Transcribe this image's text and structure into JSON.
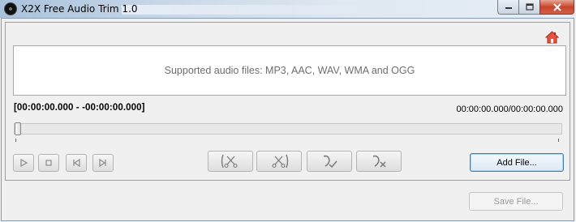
{
  "window": {
    "title": "X2X Free Audio Trim 1.0",
    "app_icon": "app-logo-icon",
    "controls": [
      "minimize-icon",
      "maximize-icon",
      "close-icon"
    ]
  },
  "toolbar": {
    "home_icon": "home-icon"
  },
  "drop_area": {
    "text": "Supported audio files: MP3, AAC, WAV, WMA and OGG"
  },
  "selection": {
    "range": "[00:00:00.000 - -00:00:00.000]"
  },
  "playback": {
    "position": "00:00:00.000/00:00:00.000",
    "progress_fraction": 0
  },
  "transport": [
    {
      "name": "play-button",
      "icon": "play-icon"
    },
    {
      "name": "stop-button",
      "icon": "stop-icon"
    },
    {
      "name": "skip-to-start-button",
      "icon": "skip-start-icon"
    },
    {
      "name": "skip-to-end-button",
      "icon": "skip-end-icon"
    }
  ],
  "edit_tools": [
    {
      "name": "trim-start-button",
      "icon": "scissors-left-icon"
    },
    {
      "name": "trim-end-button",
      "icon": "scissors-right-icon"
    },
    {
      "name": "keep-selection-button",
      "icon": "pen-check-icon"
    },
    {
      "name": "delete-selection-button",
      "icon": "pen-cross-icon"
    }
  ],
  "buttons": {
    "add_file": "Add File...",
    "save_file": "Save File..."
  },
  "colors": {
    "home_icon": "#d9442f",
    "title_close": "#c8452c",
    "add_button_border": "#3c7fb1"
  }
}
